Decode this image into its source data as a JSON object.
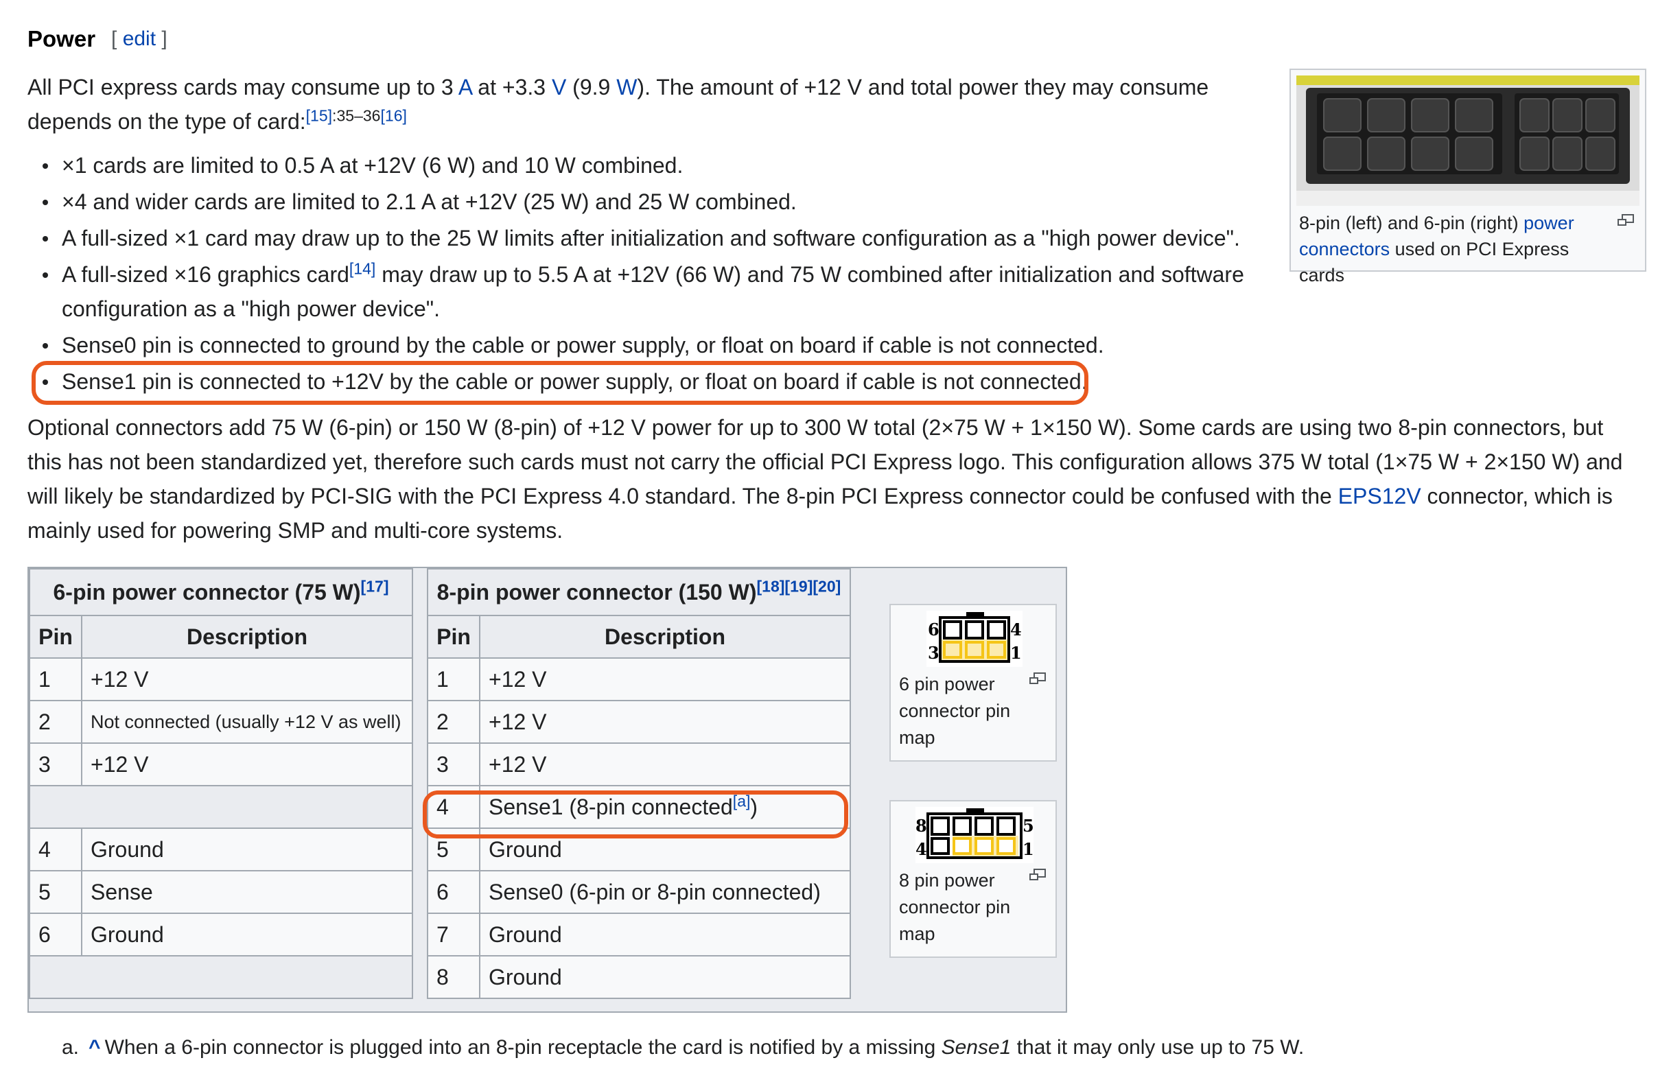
{
  "section": {
    "title": "Power",
    "edit_open": "[",
    "edit_label": "edit",
    "edit_close": "]"
  },
  "intro": {
    "t1": "All PCI express cards may consume up to 3 ",
    "link_a": "A",
    "t2": " at +3.3 ",
    "link_v": "V",
    "t3": " (9.9 ",
    "link_w": "W",
    "t4": "). The amount of +12 V and total power they may consume depends on the type of card:",
    "ref1": "[15]",
    "ref1_pages": ":35–36",
    "ref2": "[16]"
  },
  "bullets": [
    {
      "text": "×1 cards are limited to 0.5 A at +12V (6 W) and 10 W combined."
    },
    {
      "text": "×4 and wider cards are limited to 2.1 A at +12V (25 W) and 25 W combined."
    },
    {
      "text": "A full-sized ×1 card may draw up to the 25 W limits after initialization and software configuration as a \"high power device\"."
    },
    {
      "text_a": "A full-sized ×16 graphics card",
      "ref": "[14]",
      "text_b": " may draw up to 5.5 A at +12V (66 W) and 75 W combined after initialization and software configuration as a \"high power device\"."
    },
    {
      "text": "Sense0 pin is connected to ground by the cable or power supply, or float on board if cable is not connected."
    },
    {
      "text": "Sense1 pin is connected to +12V by the cable or power supply, or float on board if cable is not connected."
    }
  ],
  "optional": {
    "t1": "Optional connectors add 75 W (6-pin) or 150 W (8-pin) of +12 V power for up to 300 W total (2×75 W + 1×150 W). Some cards are using two 8-pin connectors, but this has not been standardized yet, therefore such cards must not carry the official PCI Express logo. This configuration allows 375 W total (1×75 W + 2×150 W) and will likely be standardized by PCI-SIG with the PCI Express 4.0 standard. The 8-pin PCI Express connector could be confused with the ",
    "link": "EPS12V",
    "t2": " connector, which is mainly used for powering SMP and multi-core systems."
  },
  "thumb": {
    "cap_a": "8-pin (left) and 6-pin (right) ",
    "link": "power connectors",
    "cap_b": " used on PCI Express cards"
  },
  "table6": {
    "title": "6-pin power connector (75 W)",
    "ref": "[17]",
    "col_pin": "Pin",
    "col_desc": "Description",
    "rows": [
      {
        "pin": "1",
        "desc": "+12 V"
      },
      {
        "pin": "2",
        "desc": "Not connected (usually +12 V as well)"
      },
      {
        "pin": "3",
        "desc": "+12 V"
      },
      {
        "pin": "4",
        "desc": "Ground"
      },
      {
        "pin": "5",
        "desc": "Sense"
      },
      {
        "pin": "6",
        "desc": "Ground"
      }
    ]
  },
  "table8": {
    "title": "8-pin power connector (150 W)",
    "refs": "[18][19][20]",
    "col_pin": "Pin",
    "col_desc": "Description",
    "rows": [
      {
        "pin": "1",
        "desc": "+12 V"
      },
      {
        "pin": "2",
        "desc": "+12 V"
      },
      {
        "pin": "3",
        "desc": "+12 V"
      },
      {
        "pin": "4",
        "desc": "Sense1 (8-pin connected",
        "ref": "[a]",
        "desc_end": ")"
      },
      {
        "pin": "5",
        "desc": "Ground"
      },
      {
        "pin": "6",
        "desc": "Sense0 (6-pin or 8-pin connected)"
      },
      {
        "pin": "7",
        "desc": "Ground"
      },
      {
        "pin": "8",
        "desc": "Ground"
      }
    ]
  },
  "pinmap6": {
    "caption": "6 pin power connector pin map",
    "n_tl": "6",
    "n_tr": "4",
    "n_bl": "3",
    "n_br": "1"
  },
  "pinmap8": {
    "caption": "8 pin power connector pin map",
    "n_tl": "8",
    "n_tr": "5",
    "n_bl": "4",
    "n_br": "1"
  },
  "footnote": {
    "marker": "a.",
    "caret": "^",
    "t1": "When a 6-pin connector is plugged into an 8-pin receptacle the card is notified by a missing ",
    "em": "Sense1",
    "t2": " that it may only use up to 75 W."
  },
  "colors": {
    "highlight": "#e9581e",
    "link": "#0645ad",
    "pin_yellow": "#f5c518"
  }
}
